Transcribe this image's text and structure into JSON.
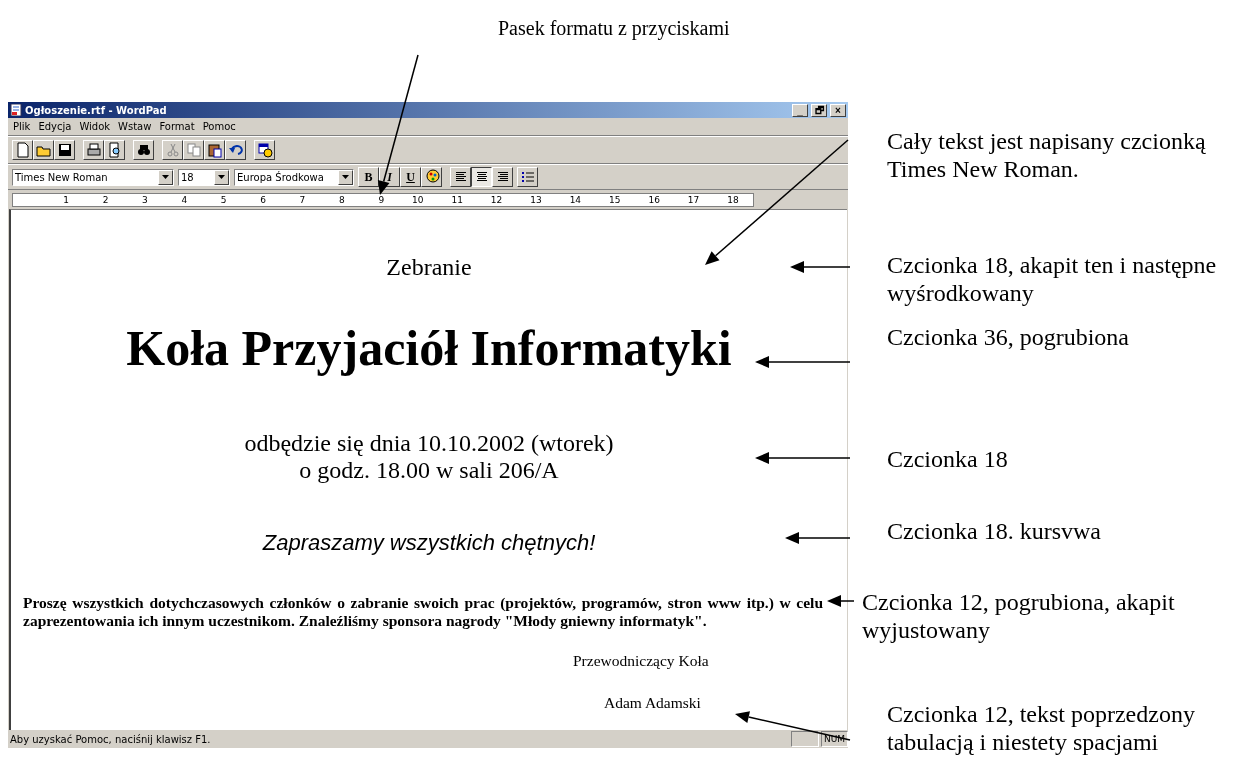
{
  "window": {
    "title": "Ogłoszenie.rtf - WordPad",
    "controls": [
      "_",
      "🗗",
      "×"
    ]
  },
  "menu": [
    {
      "label": "Plik"
    },
    {
      "label": "Edycja"
    },
    {
      "label": "Widok"
    },
    {
      "label": "Wstaw"
    },
    {
      "label": "Format"
    },
    {
      "label": "Pomoc"
    }
  ],
  "format_bar": {
    "font": "Times New Roman",
    "size": "18",
    "script": "Europa Środkowa",
    "style_buttons": [
      {
        "label": "B",
        "selected": false
      },
      {
        "label": "I",
        "selected": false
      },
      {
        "label": "U",
        "selected": false
      }
    ],
    "align_buttons": [
      {
        "selected": false
      },
      {
        "selected": true
      },
      {
        "selected": false
      }
    ]
  },
  "ruler": {
    "labels": [
      "1",
      "2",
      "3",
      "4",
      "5",
      "6",
      "7",
      "8",
      "9",
      "10",
      "11",
      "12",
      "13",
      "14",
      "15",
      "16",
      "17",
      "18"
    ]
  },
  "document": [
    {
      "kind": "plain",
      "text": "Zebranie"
    },
    {
      "kind": "title",
      "text": "Koła Przyjaciół Informatyki"
    },
    {
      "kind": "plain",
      "text": "odbędzie się dnia 10.10.2002 (wtorek)"
    },
    {
      "kind": "plain",
      "text": "o godz. 18.00 w sali 206/A"
    },
    {
      "kind": "italic",
      "text": "Zapraszamy wszystkich chętnych!"
    },
    {
      "kind": "bold",
      "text": "Proszę wszystkich dotychczasowych członków o zabranie swoich prac (projektów, programów, stron www itp.) w celu zaprezentowania ich innym uczestnikom. Znaleźliśmy sponsora nagrody \"Młody gniewny informatyk\"."
    },
    {
      "kind": "signature",
      "text": "Przewodniczący Koła"
    },
    {
      "kind": "signature2",
      "text": "Adam Adamski"
    }
  ],
  "status_bar": {
    "text": "Aby uzyskać Pomoc, naciśnij klawisz F1.",
    "indicators": [
      "NUM"
    ]
  },
  "annotations": [
    {
      "text": "Pasek formatu z przyciskami"
    },
    {
      "text": "Cały tekst jest napisany czcionką Times New Roman."
    },
    {
      "text": "Czcionka 18, akapit ten i następne wyśrodkowany"
    },
    {
      "text": "Czcionka 36, pogrubiona"
    },
    {
      "text": "Czcionka 18"
    },
    {
      "text": "Czcionka 18. kursvwa"
    },
    {
      "text": "Czcionka 12, pogrubiona, akapit wyjustowany"
    },
    {
      "text": "Czcionka 12, tekst poprzedzony tabulacją i niestety spacjami"
    }
  ]
}
